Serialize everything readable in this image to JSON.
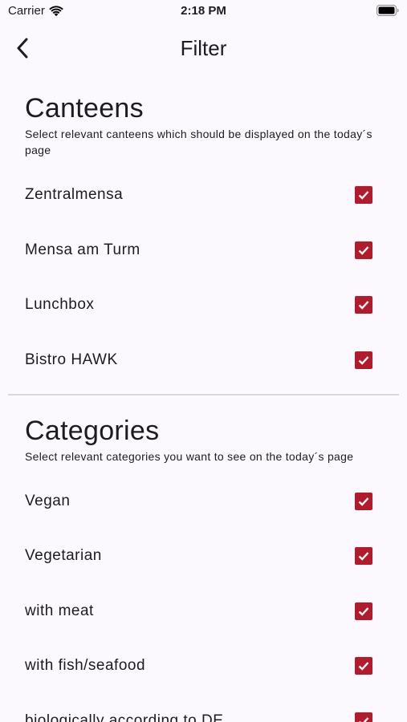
{
  "status_bar": {
    "carrier": "Carrier",
    "time": "2:18 PM"
  },
  "app_bar": {
    "title": "Filter",
    "back_icon": "chevron-left-icon"
  },
  "colors": {
    "accent": "#b31b2c",
    "background": "#fbf9fd"
  },
  "canteens": {
    "title": "Canteens",
    "description": "Select relevant canteens which should be displayed on the today´s page",
    "items": [
      {
        "label": "Zentralmensa",
        "checked": true
      },
      {
        "label": "Mensa am Turm",
        "checked": true
      },
      {
        "label": "Lunchbox",
        "checked": true
      },
      {
        "label": "Bistro HAWK",
        "checked": true
      }
    ]
  },
  "categories": {
    "title": "Categories",
    "description": "Select relevant categories you want to see on the today´s page",
    "items": [
      {
        "label": "Vegan",
        "checked": true
      },
      {
        "label": "Vegetarian",
        "checked": true
      },
      {
        "label": "with meat",
        "checked": true
      },
      {
        "label": "with fish/seafood",
        "checked": true
      },
      {
        "label": "biologically according to DE",
        "checked": true
      }
    ]
  }
}
